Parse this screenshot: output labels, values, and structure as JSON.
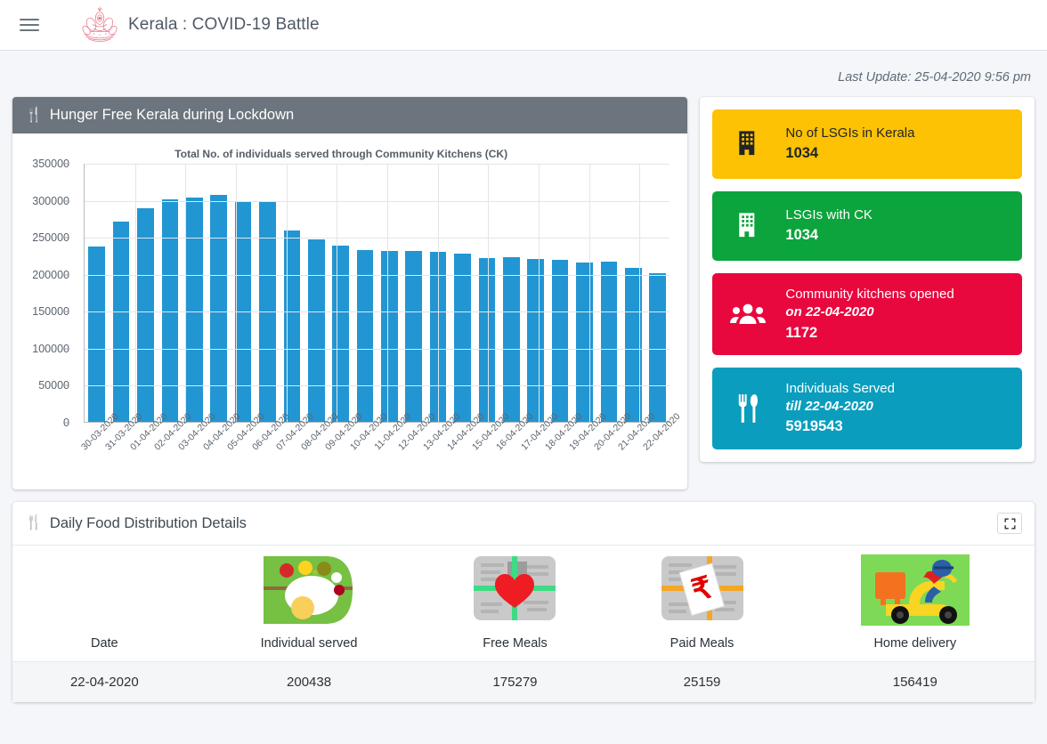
{
  "navbar": {
    "menu_icon": "hamburger-icon",
    "logo_icon": "kerala-government-emblem",
    "title": "Kerala : COVID-19 Battle"
  },
  "last_update": "Last Update: 25-04-2020 9:56 pm",
  "chart_panel": {
    "header_icon": "fork-knife-icon",
    "header_title": "Hunger Free Kerala during Lockdown"
  },
  "stats": {
    "cards": [
      {
        "icon": "building-icon",
        "label": "No of LSGIs in Kerala",
        "sub": "",
        "value": "1034",
        "bg": "#fcc203",
        "fg": "#212529"
      },
      {
        "icon": "building-icon",
        "label": "LSGIs with CK",
        "sub": "",
        "value": "1034",
        "bg": "#0ca43c",
        "fg": "#ffffff"
      },
      {
        "icon": "people-group-icon",
        "label": "Community kitchens opened",
        "sub": "on 22-04-2020",
        "value": "1172",
        "bg": "#e8083e",
        "fg": "#ffffff"
      },
      {
        "icon": "fork-knife-icon",
        "label": "Individuals Served",
        "sub": "till 22-04-2020",
        "value": "5919543",
        "bg": "#0b9dbd",
        "fg": "#ffffff"
      }
    ]
  },
  "table_panel": {
    "header_icon": "fork-knife-icon",
    "header_title": "Daily Food Distribution Details",
    "expand_icon": "fullscreen-icon",
    "columns": [
      {
        "label": "Date",
        "icon": ""
      },
      {
        "label": "Individual served",
        "icon": "meal-plate-icon"
      },
      {
        "label": "Free Meals",
        "icon": "free-meal-heart-icon"
      },
      {
        "label": "Paid Meals",
        "icon": "paid-meal-rupee-icon"
      },
      {
        "label": "Home delivery",
        "icon": "scooter-delivery-icon"
      }
    ],
    "rows": [
      [
        "22-04-2020",
        "200438",
        "175279",
        "25159",
        "156419"
      ]
    ]
  },
  "chart_data": {
    "type": "bar",
    "title": "Total No. of individuals served through Community Kitchens (CK)",
    "xlabel": "",
    "ylabel": "",
    "ylim": [
      0,
      350000
    ],
    "yticks": [
      0,
      50000,
      100000,
      150000,
      200000,
      250000,
      300000,
      350000
    ],
    "grid": true,
    "legend": false,
    "bar_color": "#2196d3",
    "categories": [
      "30-03-2020",
      "31-03-2020",
      "01-04-2020",
      "02-04-2020",
      "03-04-2020",
      "04-04-2020",
      "05-04-2020",
      "06-04-2020",
      "07-04-2020",
      "08-04-2020",
      "09-04-2020",
      "10-04-2020",
      "11-04-2020",
      "12-04-2020",
      "13-04-2020",
      "14-04-2020",
      "15-04-2020",
      "16-04-2020",
      "17-04-2020",
      "18-04-2020",
      "19-04-2020",
      "20-04-2020",
      "21-04-2020",
      "22-04-2020"
    ],
    "values": [
      236500,
      270800,
      288100,
      300800,
      303200,
      306800,
      297800,
      297700,
      258800,
      246200,
      238000,
      232100,
      231500,
      231200,
      229800,
      227400,
      221700,
      222000,
      220000,
      218500,
      215200,
      217000,
      208600,
      200438
    ]
  }
}
